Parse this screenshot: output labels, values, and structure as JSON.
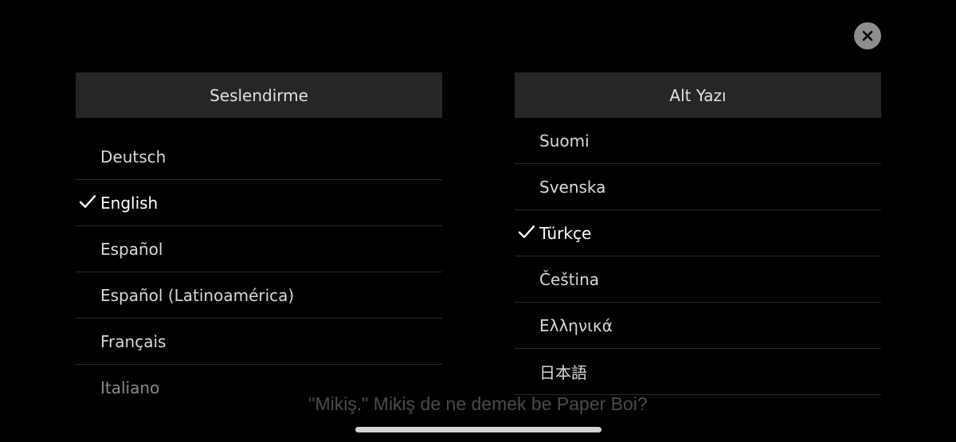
{
  "close": {
    "icon": "close-icon"
  },
  "audio": {
    "title": "Seslendirme",
    "items": [
      {
        "label": "Deutsch",
        "selected": false
      },
      {
        "label": "English",
        "selected": true
      },
      {
        "label": "Español",
        "selected": false
      },
      {
        "label": "Español (Latinoamérica)",
        "selected": false
      },
      {
        "label": "Français",
        "selected": false
      },
      {
        "label": "Italiano",
        "selected": false
      }
    ]
  },
  "subtitles": {
    "title": "Alt Yazı",
    "items": [
      {
        "label": "Suomi",
        "selected": false
      },
      {
        "label": "Svenska",
        "selected": false
      },
      {
        "label": "Türkçe",
        "selected": true
      },
      {
        "label": "Čeština",
        "selected": false
      },
      {
        "label": "Ελληνικά",
        "selected": false
      },
      {
        "label": "日本語",
        "selected": false
      }
    ]
  },
  "caption": "\"Mikiş.\" Mikiş de ne demek be Paper Boi?",
  "colors": {
    "background": "#000000",
    "header": "#262626",
    "close_button": "#8e8e8e"
  }
}
